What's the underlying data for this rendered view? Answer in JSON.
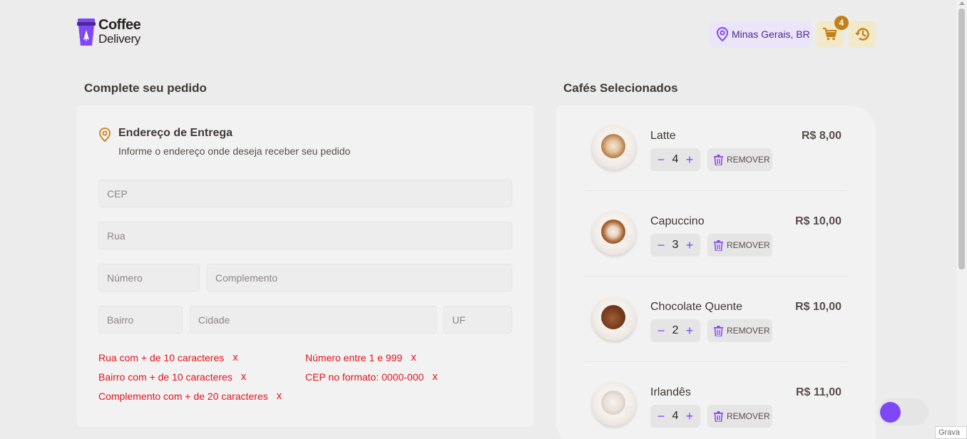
{
  "header": {
    "logo_line1": "Coffee",
    "logo_line2": "Delivery",
    "location": "Minas Gerais, BR",
    "cart_count": "4"
  },
  "checkout": {
    "title": "Complete seu pedido",
    "address_title": "Endereço de Entrega",
    "address_subtitle": "Informe o endereço onde deseja receber seu pedido",
    "placeholders": {
      "cep": "CEP",
      "rua": "Rua",
      "numero": "Número",
      "complemento": "Complemento",
      "bairro": "Bairro",
      "cidade": "Cidade",
      "uf": "UF"
    },
    "errors": [
      "Rua com + de 10 caracteres",
      "Número entre 1 e 999",
      "Bairro com + de 10 caracteres",
      "CEP no formato: 0000-000",
      "Complemento com + de 20 caracteres"
    ],
    "error_close": "x"
  },
  "cart": {
    "title": "Cafés Selecionados",
    "remove_label": "REMOVER",
    "items": [
      {
        "name": "Latte",
        "price": "R$ 8,00",
        "qty": "4"
      },
      {
        "name": "Capuccino",
        "price": "R$ 10,00",
        "qty": "3"
      },
      {
        "name": "Chocolate Quente",
        "price": "R$ 10,00",
        "qty": "2"
      },
      {
        "name": "Irlandês",
        "price": "R$ 11,00",
        "qty": "4"
      }
    ]
  },
  "minus": "−",
  "plus": "+",
  "grava_label": "Grava",
  "colors": {
    "purple": "#8047f8",
    "purple_dark": "#4b2995",
    "yellow": "#c47f17",
    "yellow_light": "#f1e9c9",
    "error": "#e1141d"
  }
}
